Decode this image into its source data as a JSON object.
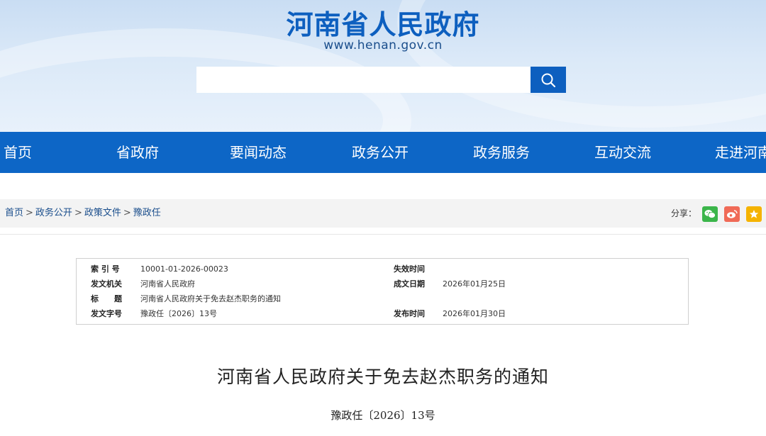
{
  "header": {
    "site_title": "河南省人民政府",
    "site_url": "www.henan.gov.cn",
    "search_placeholder": "",
    "search_value": ""
  },
  "nav": {
    "items": [
      {
        "label": "首页"
      },
      {
        "label": "省政府"
      },
      {
        "label": "要闻动态"
      },
      {
        "label": "政务公开"
      },
      {
        "label": "政务服务"
      },
      {
        "label": "互动交流"
      },
      {
        "label": "走进河南"
      }
    ]
  },
  "breadcrumb": {
    "items": [
      "首页",
      "政务公开",
      "政策文件",
      "豫政任"
    ],
    "separator": ">"
  },
  "share": {
    "label": "分享：",
    "icons": [
      "wechat-icon",
      "weibo-icon",
      "favorite-icon"
    ]
  },
  "meta": {
    "index_label": "索 引 号",
    "index_value": "10001-01-2026-00023",
    "expire_label": "失效时间",
    "expire_value": "",
    "issuer_label": "发文机关",
    "issuer_value": "河南省人民政府",
    "created_label": "成文日期",
    "created_value": "2026年01月25日",
    "title_label": "标　　题",
    "title_value": "河南省人民政府关于免去赵杰职务的通知",
    "docno_label": "发文字号",
    "docno_value": "豫政任〔2026〕13号",
    "published_label": "发布时间",
    "published_value": "2026年01月30日"
  },
  "document": {
    "title": "河南省人民政府关于免去赵杰职务的通知",
    "number": "豫政任〔2026〕13号"
  },
  "colors": {
    "brand_blue": "#0d66c6",
    "title_blue": "#0d5fbf",
    "wechat": "#3bb54a",
    "weibo": "#f06a57",
    "favorite": "#f5b300"
  }
}
